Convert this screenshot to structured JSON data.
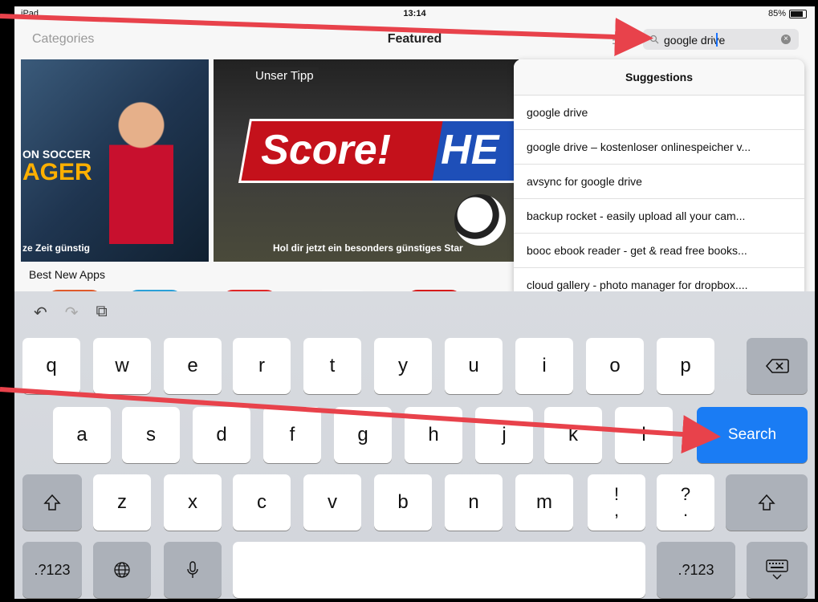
{
  "status_bar": {
    "device": "iPad",
    "time": "13:14",
    "battery": "85%"
  },
  "nav": {
    "categories_label": "Categories",
    "title": "Featured",
    "list_icon": "list-icon"
  },
  "search": {
    "value": "google drive",
    "clear_icon": "clear-icon",
    "search_icon": "magnifier-icon"
  },
  "banners": {
    "left": {
      "line1": "ON SOCCER",
      "line2": "AGER",
      "caption": "ze Zeit günstig"
    },
    "center": {
      "tag": "Unser Tipp",
      "title_part1": "Score!",
      "title_part2": "HE",
      "caption": "Hol dir jetzt ein besonders günstiges Star"
    }
  },
  "section_title": "Best New Apps",
  "suggestions": {
    "header": "Suggestions",
    "items": [
      "google drive",
      "google drive – kostenloser onlinespeicher v...",
      "avsync for google drive",
      "backup rocket - easily upload all your cam...",
      "booc ebook reader - get & read free books...",
      "cloud gallery - photo manager for dropbox...."
    ]
  },
  "keyboard": {
    "tools": [
      "undo-icon",
      "redo-icon",
      "paste-icon"
    ],
    "row1": [
      "q",
      "w",
      "e",
      "r",
      "t",
      "y",
      "u",
      "i",
      "o",
      "p"
    ],
    "row2": [
      "a",
      "s",
      "d",
      "f",
      "g",
      "h",
      "j",
      "k",
      "l"
    ],
    "row3": [
      "z",
      "x",
      "c",
      "v",
      "b",
      "n",
      "m"
    ],
    "punct1": {
      "top": "!",
      "bottom": ","
    },
    "punct2": {
      "top": "?",
      "bottom": "."
    },
    "search_label": "Search",
    "numbers_label": ".?123",
    "numbers_label_right": ".?123"
  },
  "colors": {
    "accent": "#1a7cf4",
    "annotation_arrow": "#e8424b"
  }
}
